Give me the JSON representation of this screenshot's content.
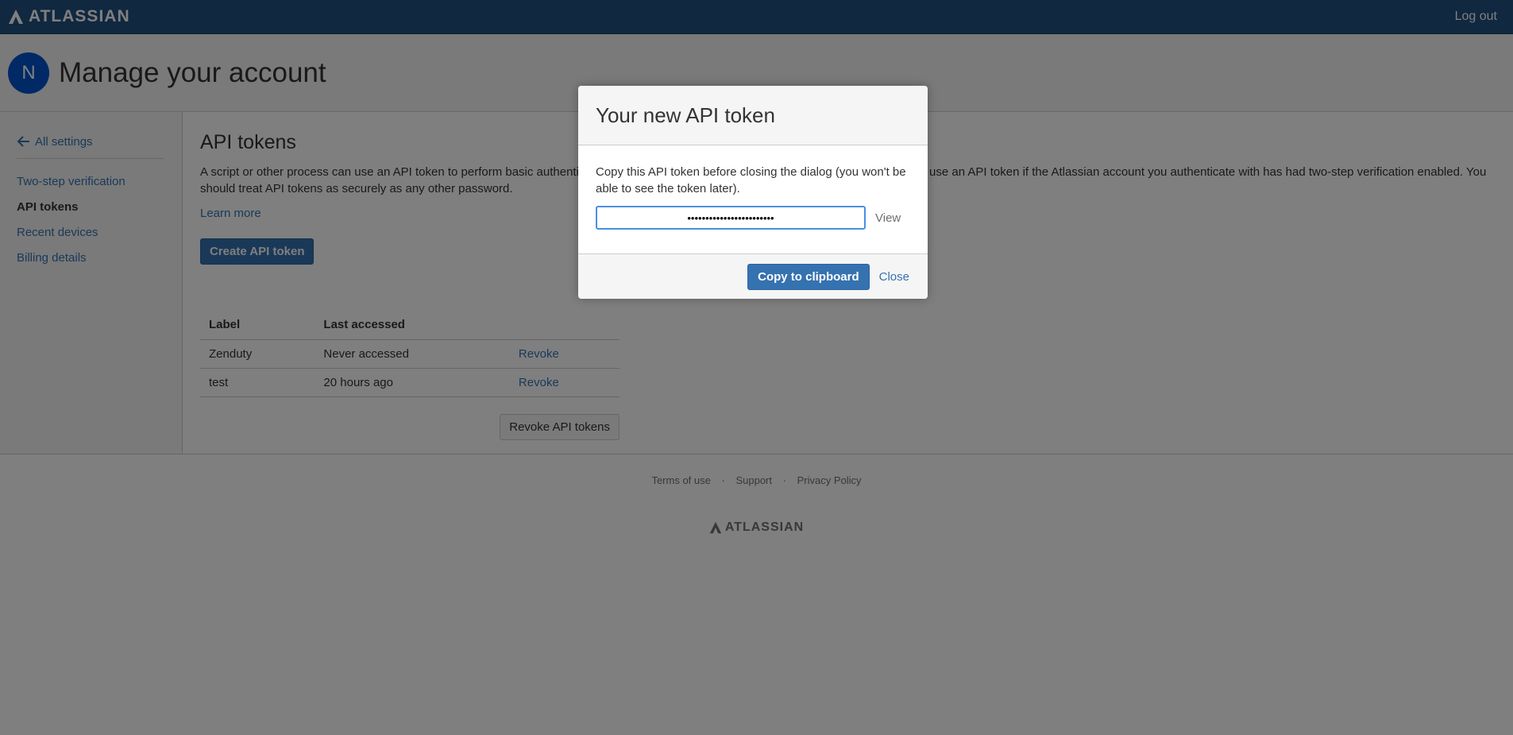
{
  "topbar": {
    "brand": "ATLASSIAN",
    "logout_label": "Log out"
  },
  "header": {
    "avatar_initial": "N",
    "title": "Manage your account"
  },
  "sidebar": {
    "back_label": "All settings",
    "items": [
      {
        "label": "Two-step verification",
        "active": false
      },
      {
        "label": "API tokens",
        "active": true
      },
      {
        "label": "Recent devices",
        "active": false
      },
      {
        "label": "Billing details",
        "active": false
      }
    ]
  },
  "main": {
    "title": "API tokens",
    "description": "A script or other process can use an API token to perform basic authentication with Jira Cloud applications or Confluence Cloud. You must use an API token if the Atlassian account you authenticate with has had two-step verification enabled. You should treat API tokens as securely as any other password.",
    "learn_more": "Learn more",
    "create_button": "Create API token",
    "table": {
      "headers": [
        "Label",
        "Last accessed",
        ""
      ],
      "rows": [
        {
          "label": "Zenduty",
          "last_accessed": "Never accessed",
          "action": "Revoke"
        },
        {
          "label": "test",
          "last_accessed": "20 hours ago",
          "action": "Revoke"
        }
      ]
    },
    "revoke_all_button": "Revoke API tokens"
  },
  "footer": {
    "links": [
      "Terms of use",
      "Support",
      "Privacy Policy"
    ],
    "separator": "·",
    "brand": "ATLASSIAN"
  },
  "dialog": {
    "title": "Your new API token",
    "message": "Copy this API token before closing the dialog (you won't be able to see the token later).",
    "token_masked": "••••••••••••••••••••••••",
    "view_label": "View",
    "copy_button": "Copy to clipboard",
    "close_label": "Close"
  },
  "colors": {
    "topbar": "#205081",
    "link": "#3572b0",
    "avatar": "#0052cc",
    "overlay": "rgba(0,0,0,0.5)"
  }
}
